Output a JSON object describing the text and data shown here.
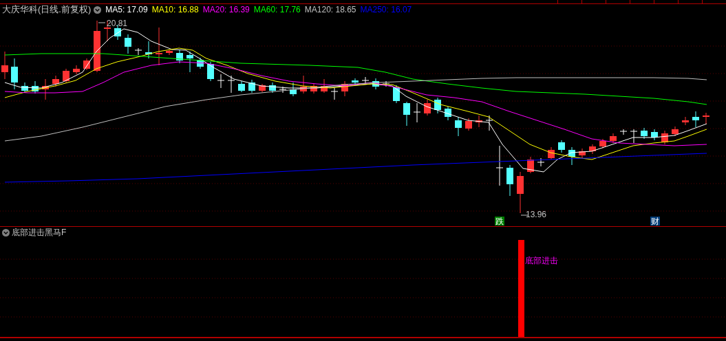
{
  "main_panel": {
    "title": "大庆华科(日线.前复权)",
    "moving_averages": [
      {
        "label": "MA5: 17.09",
        "color": "#ffffff"
      },
      {
        "label": "MA10: 16.88",
        "color": "#ffff00"
      },
      {
        "label": "MA20: 16.39",
        "color": "#ff00ff"
      },
      {
        "label": "MA60: 17.76",
        "color": "#00ff00"
      },
      {
        "label": "MA120: 18.65",
        "color": "#c0c0c0"
      },
      {
        "label": "MA250: 16.07",
        "color": "#0000ff"
      }
    ],
    "price_marks": [
      {
        "kind": "high",
        "label": "20.81"
      },
      {
        "kind": "low",
        "label": "13.96"
      }
    ],
    "badges": [
      {
        "label": "跌",
        "color": "#008000"
      },
      {
        "label": "财",
        "color": "#003c78"
      }
    ]
  },
  "indicator_panel": {
    "title": "底部进击黑马F",
    "signal_label": "底部进击"
  }
}
